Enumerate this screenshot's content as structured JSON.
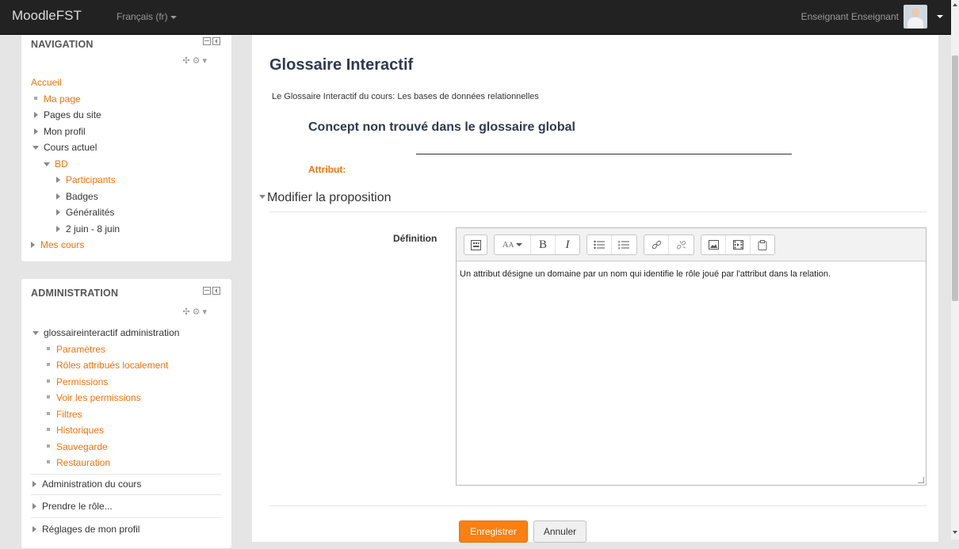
{
  "navbar": {
    "brand": "MoodleFST",
    "language": "Français (fr)",
    "user_name": "Enseignant Enseignant"
  },
  "navigation": {
    "title": "NAVIGATION",
    "home": "Accueil",
    "items": [
      {
        "label": "Ma page"
      },
      {
        "label": "Pages du site"
      },
      {
        "label": "Mon profil"
      },
      {
        "label": "Cours actuel"
      },
      {
        "label": "BD"
      },
      {
        "label": "Participants"
      },
      {
        "label": "Badges"
      },
      {
        "label": "Généralités"
      },
      {
        "label": "2 juin - 8 juin"
      },
      {
        "label": "Mes cours"
      }
    ]
  },
  "administration": {
    "title": "ADMINISTRATION",
    "group": "glossaireinteractif administration",
    "items": [
      {
        "label": "Paramètres"
      },
      {
        "label": "Rôles attribués localement"
      },
      {
        "label": "Permissions"
      },
      {
        "label": "Voir les permissions"
      },
      {
        "label": "Filtres"
      },
      {
        "label": "Historiques"
      },
      {
        "label": "Sauvegarde"
      },
      {
        "label": "Restauration"
      }
    ],
    "sections": [
      {
        "label": "Administration du cours"
      },
      {
        "label": "Prendre le rôle..."
      },
      {
        "label": "Réglages de mon profil"
      }
    ]
  },
  "main": {
    "title": "Glossaire Interactif",
    "intro": "Le Glossaire Interactif du cours: Les bases de données relationnelles",
    "concept_title": "Concept non trouvé dans le glossaire global",
    "attribute_label": "Attribut:",
    "legend": "Modifier la proposition",
    "definition_label": "Définition",
    "editor_text": "Un attribut désigne un domaine par un nom qui identifie le rôle joué par l'attribut dans la relation.",
    "save_label": "Enregistrer",
    "cancel_label": "Annuler"
  },
  "colors": {
    "accent": "#f98012",
    "link": "#f7710b",
    "navbar": "#222222",
    "title": "#2f3a4f"
  }
}
